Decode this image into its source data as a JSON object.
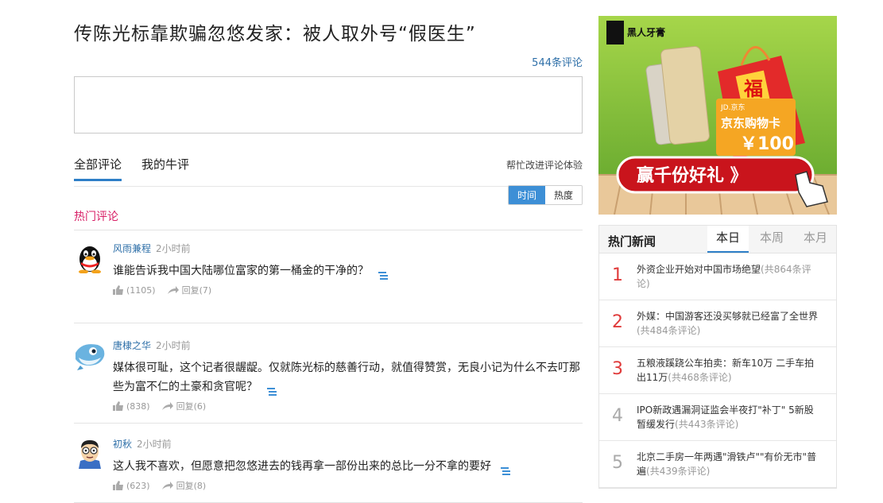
{
  "article": {
    "title": "传陈光标靠欺骗忽悠发家：被人取外号“假医生”",
    "comment_count": "544条评论"
  },
  "tabs": {
    "all": "全部评论",
    "mine": "我的牛评",
    "help": "帮忙改进评论体验"
  },
  "sort": {
    "time": "时间",
    "heat": "热度"
  },
  "hot_label": "热门评论",
  "comments": [
    {
      "user": "风雨兼程",
      "time": "2小时前",
      "text": "谁能告诉我中国大陆哪位富家的第一桶金的干净的？",
      "likes": "(1105)",
      "reply_label": "回复",
      "replies": "(7)"
    },
    {
      "user": "唐棣之华",
      "time": "2小时前",
      "text": "媒体很可耻，这个记者很龌龊。仅就陈光标的慈善行动，就值得赞赏，无良小记为什么不去叮那些为富不仁的土豪和贪官呢？",
      "likes": "(838)",
      "reply_label": "回复",
      "replies": "(6)"
    },
    {
      "user": "初秋",
      "time": "2小时前",
      "text": "这人我不喜欢，但愿意把忽悠进去的钱再拿一部份出来的总比一分不拿的要好",
      "likes": "(623)",
      "reply_label": "回复",
      "replies": "(8)"
    }
  ],
  "ad": {
    "brand": "黑人牙膏",
    "card": "京东购物卡",
    "jd": "JD.京东",
    "amount": "￥100",
    "fu": "福",
    "cta": "赢千份好礼 》"
  },
  "hot_news": {
    "title": "热门新闻",
    "tabs": [
      "本日",
      "本周",
      "本月"
    ],
    "items": [
      {
        "num": "1",
        "text": "外资企业开始对中国市场绝望",
        "count": "(共864条评论)"
      },
      {
        "num": "2",
        "text": "外媒：中国游客还没买够就已经富了全世界",
        "count": "(共484条评论)"
      },
      {
        "num": "3",
        "text": "五粮液蹊跷公车拍卖：新车10万 二手车拍出11万",
        "count": "(共468条评论)"
      },
      {
        "num": "4",
        "text": "IPO新政遇漏洞证监会半夜打\"补丁\" 5新股暂缓发行",
        "count": "(共443条评论)"
      },
      {
        "num": "5",
        "text": "北京二手房一年两遇\"滑铁卢\"\"有价无市\"普遍",
        "count": "(共439条评论)"
      }
    ]
  },
  "colors": {
    "accent": "#2e7fc7",
    "hot": "#d81f66",
    "rank_top": "#e03b3b",
    "rank_rest": "#aaaaaa"
  }
}
